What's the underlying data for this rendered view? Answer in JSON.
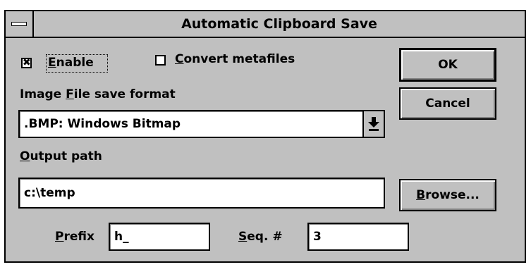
{
  "dialog": {
    "title": "Automatic Clipboard Save"
  },
  "enable": {
    "label_mnemonic": "E",
    "label_rest": "nable",
    "checked": true,
    "mark": "✖"
  },
  "convert_metafiles": {
    "label_mnemonic": "C",
    "label_rest": "onvert metafiles",
    "checked": false
  },
  "image_format": {
    "label_pre": "Image ",
    "label_mnemonic": "F",
    "label_rest": "ile save format",
    "value": ".BMP: Windows Bitmap"
  },
  "output_path": {
    "label_mnemonic": "O",
    "label_rest": "utput path",
    "value": "c:\\temp"
  },
  "prefix": {
    "label_mnemonic": "P",
    "label_rest": "refix",
    "value": "h_"
  },
  "seq": {
    "label_mnemonic": "S",
    "label_rest": "eq. #",
    "value": "3"
  },
  "buttons": {
    "ok": "OK",
    "cancel": "Cancel",
    "browse_mnemonic": "B",
    "browse_rest": "rowse..."
  },
  "icons": {
    "system_menu": "system-menu-icon",
    "dropdown": "dropdown-arrow-icon"
  }
}
